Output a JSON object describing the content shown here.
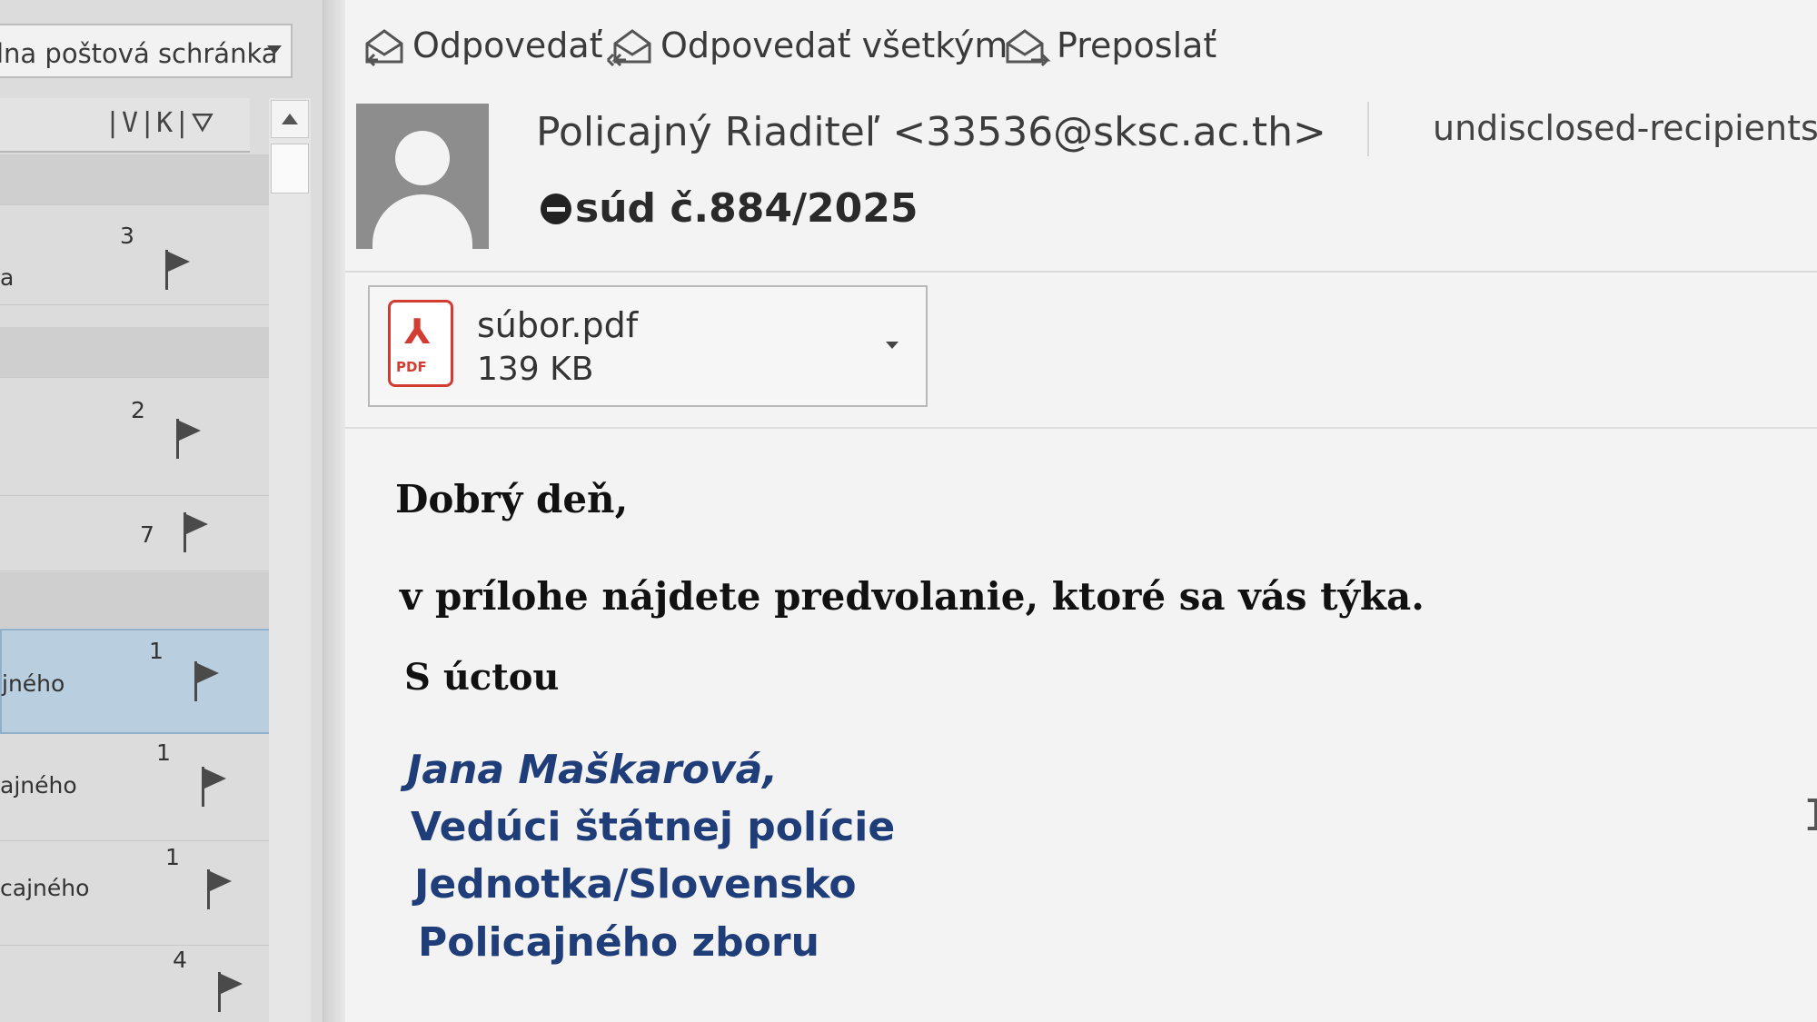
{
  "mailbox": {
    "selected": "lna poštová schránka"
  },
  "list_header": {
    "icons": "|V|K|⛛"
  },
  "mail_list": [
    {
      "count": "3",
      "sender": "a"
    },
    {
      "count": "2",
      "sender": ""
    },
    {
      "count": "7",
      "sender": ""
    },
    {
      "count": "1",
      "sender": "jného"
    },
    {
      "count": "1",
      "sender": "ajného"
    },
    {
      "count": "1",
      "sender": "cajného"
    },
    {
      "count": "4",
      "sender": ""
    }
  ],
  "toolbar": {
    "reply": "Odpovedať",
    "reply_all": "Odpovedať všetkým",
    "forward": "Preposlať"
  },
  "message": {
    "from": "Policajný Riaditeľ <33536@sksc.ac.th>",
    "to": "undisclosed-recipients",
    "subject": "súd č.884/2025"
  },
  "attachment": {
    "name": "súbor.pdf",
    "size": "139 KB",
    "icon": "pdf-icon",
    "icon_label": "PDF"
  },
  "body": {
    "greeting": "Dobrý deň,",
    "line1": "v prílohe nájdete predvolanie, ktoré sa vás týka.",
    "closing": "S úctou"
  },
  "signature": {
    "name": "Jana Maškarová,",
    "title": "Vedúci štátnej polície",
    "unit": "Jednotka/Slovensko",
    "org": "Policajného zboru"
  },
  "colors": {
    "signature": "#1f3d78",
    "selected_row": "#b9cfdf",
    "pdf_red": "#d23c31"
  }
}
